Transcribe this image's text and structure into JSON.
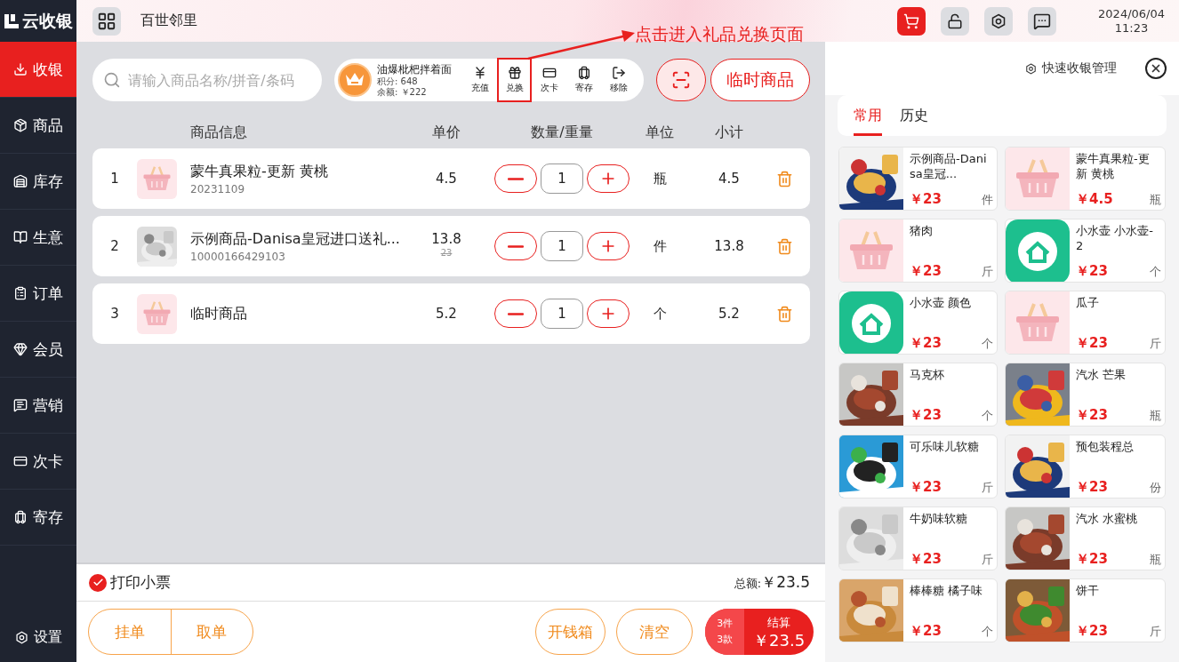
{
  "brand": "云收银",
  "sidebar": {
    "items": [
      {
        "label": "收银",
        "selected": true
      },
      {
        "label": "商品",
        "selected": false
      },
      {
        "label": "库存",
        "selected": false
      },
      {
        "label": "生意",
        "selected": false
      },
      {
        "label": "订单",
        "selected": false
      },
      {
        "label": "会员",
        "selected": false
      },
      {
        "label": "营销",
        "selected": false
      },
      {
        "label": "次卡",
        "selected": false
      },
      {
        "label": "寄存",
        "selected": false
      }
    ],
    "settings": "设置"
  },
  "header": {
    "store": "百世邻里",
    "date": "2024/06/04",
    "time": "11:23"
  },
  "search": {
    "placeholder": "请输入商品名称/拼音/条码"
  },
  "member": {
    "name": "油爆枇杷拌着面",
    "points": "积分: 648",
    "balance": "余额: ￥222",
    "actions": [
      {
        "label": "充值",
        "highlighted": false
      },
      {
        "label": "兑换",
        "highlighted": true
      },
      {
        "label": "次卡",
        "highlighted": false
      },
      {
        "label": "寄存",
        "highlighted": false
      },
      {
        "label": "移除",
        "highlighted": false
      }
    ]
  },
  "temp_button": "临时商品",
  "annotation": "点击进入礼品兑换页面",
  "cart": {
    "columns": [
      "商品信息",
      "单价",
      "数量/重量",
      "单位",
      "小计"
    ],
    "rows": [
      {
        "index": "1",
        "kind": "basket",
        "name": "蒙牛真果粒-更新 黄桃",
        "code": "20231109",
        "price": "4.5",
        "qty": "1",
        "unit": "瓶",
        "subtotal": "4.5"
      },
      {
        "index": "2",
        "kind": "picture",
        "name": "示例商品-Danisa皇冠进口送礼...",
        "code": "10000166429103",
        "price": "13.8",
        "original_price": "23",
        "qty": "1",
        "unit": "件",
        "subtotal": "13.8"
      },
      {
        "index": "3",
        "kind": "basket",
        "name": "临时商品",
        "price": "5.2",
        "qty": "1",
        "unit": "个",
        "subtotal": "5.2"
      }
    ]
  },
  "footer": {
    "print_receipt": {
      "label": "打印小票",
      "checked": true
    },
    "total_label": "总额:",
    "total": "￥23.5",
    "hold": "挂单",
    "retrieve": "取单",
    "cash_drawer": "开钱箱",
    "clear": "清空",
    "checkout": {
      "items": "3件",
      "kinds": "3款",
      "label": "结算",
      "amount": "￥23.5"
    }
  },
  "quick": {
    "manage": "快速收银管理",
    "tabs": [
      {
        "label": "常用",
        "selected": true
      },
      {
        "label": "历史",
        "selected": false
      }
    ],
    "products": [
      {
        "name": "示例商品-Danisa皇冠...",
        "price": "￥23",
        "unit": "件",
        "kind": "picture"
      },
      {
        "name": "蒙牛真果粒-更新 黄桃",
        "price": "￥4.5",
        "unit": "瓶",
        "kind": "basket"
      },
      {
        "name": "猪肉",
        "price": "￥23",
        "unit": "斤",
        "kind": "basket"
      },
      {
        "name": "小水壶 小水壶-2",
        "price": "￥23",
        "unit": "个",
        "kind": "app"
      },
      {
        "name": "小水壶 颜色",
        "price": "￥23",
        "unit": "个",
        "kind": "app"
      },
      {
        "name": "瓜子",
        "price": "￥23",
        "unit": "斤",
        "kind": "basket"
      },
      {
        "name": "马克杯",
        "price": "￥23",
        "unit": "个",
        "kind": "picture"
      },
      {
        "name": "汽水 芒果",
        "price": "￥23",
        "unit": "瓶",
        "kind": "picture"
      },
      {
        "name": "可乐味儿软糖",
        "price": "￥23",
        "unit": "斤",
        "kind": "picture"
      },
      {
        "name": "预包装程总",
        "price": "￥23",
        "unit": "份",
        "kind": "picture"
      },
      {
        "name": "牛奶味软糖",
        "price": "￥23",
        "unit": "斤",
        "kind": "picture"
      },
      {
        "name": "汽水 水蜜桃",
        "price": "￥23",
        "unit": "瓶",
        "kind": "picture"
      },
      {
        "name": "棒棒糖 橘子味",
        "price": "￥23",
        "unit": "个",
        "kind": "picture"
      },
      {
        "name": "饼干",
        "price": "￥23",
        "unit": "斤",
        "kind": "picture"
      }
    ]
  }
}
